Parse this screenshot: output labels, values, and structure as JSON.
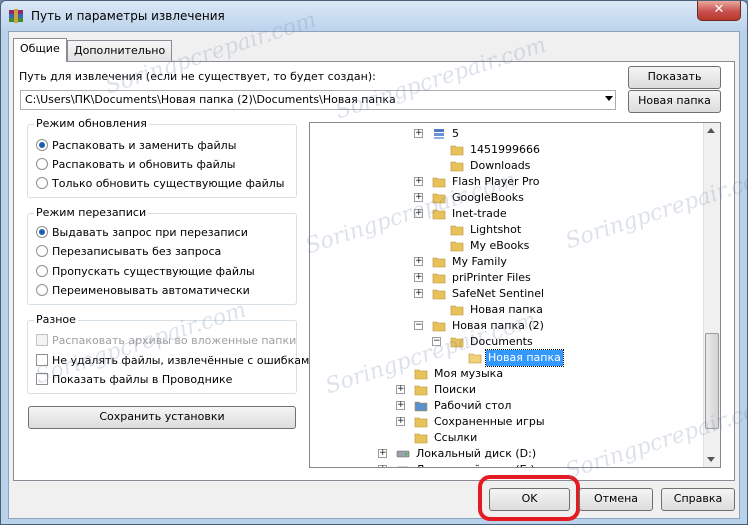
{
  "window": {
    "title": "Путь и параметры извлечения",
    "close_glyph": "✕"
  },
  "tabs": [
    {
      "label": "Общие",
      "active": true
    },
    {
      "label": "Дополнительно",
      "active": false
    }
  ],
  "path": {
    "label": "Путь для извлечения (если не существует, то будет создан):",
    "value": "C:\\Users\\ПК\\Documents\\Новая папка (2)\\Documents\\Новая папка",
    "show_button": "Показать",
    "new_folder_button": "Новая папка"
  },
  "update_mode": {
    "title": "Режим обновления",
    "options": [
      {
        "label": "Распаковать и заменить файлы",
        "selected": true
      },
      {
        "label": "Распаковать и обновить файлы",
        "selected": false
      },
      {
        "label": "Только обновить существующие файлы",
        "selected": false
      }
    ]
  },
  "overwrite_mode": {
    "title": "Режим перезаписи",
    "options": [
      {
        "label": "Выдавать запрос при перезаписи",
        "selected": true
      },
      {
        "label": "Перезаписывать без запроса",
        "selected": false
      },
      {
        "label": "Пропускать существующие файлы",
        "selected": false
      },
      {
        "label": "Переименовывать автоматически",
        "selected": false
      }
    ]
  },
  "misc": {
    "title": "Разное",
    "options": [
      {
        "label": "Распаковать архивы во вложенные папки",
        "checked": false,
        "disabled": true
      },
      {
        "label": "Не удалять файлы, извлечённые с ошибками",
        "checked": false,
        "disabled": false
      },
      {
        "label": "Показать файлы в Проводнике",
        "checked": false,
        "disabled": false
      }
    ]
  },
  "save_settings_button": "Сохранить установки",
  "tree": {
    "items": [
      {
        "label": "5",
        "icon": "stack-icon",
        "expander": "+"
      },
      {
        "label": "1451999666",
        "icon": "folder-icon",
        "expander": ""
      },
      {
        "label": "Downloads",
        "icon": "folder-icon",
        "expander": ""
      },
      {
        "label": "Flash Player Pro",
        "icon": "folder-icon",
        "expander": "+"
      },
      {
        "label": "GoogleBooks",
        "icon": "folder-icon",
        "expander": "+"
      },
      {
        "label": "Inet-trade",
        "icon": "folder-icon",
        "expander": "+"
      },
      {
        "label": "Lightshot",
        "icon": "folder-icon",
        "expander": ""
      },
      {
        "label": "My eBooks",
        "icon": "folder-icon",
        "expander": ""
      },
      {
        "label": "My Family",
        "icon": "folder-icon",
        "expander": "+"
      },
      {
        "label": "priPrinter Files",
        "icon": "folder-icon",
        "expander": "+"
      },
      {
        "label": "SafeNet Sentinel",
        "icon": "folder-icon",
        "expander": "+"
      },
      {
        "label": "Новая папка",
        "icon": "folder-icon",
        "expander": ""
      },
      {
        "label": "Новая папка (2)",
        "icon": "folder-icon",
        "expander": "−"
      },
      {
        "label": "Documents",
        "icon": "folder-icon",
        "expander": "−"
      },
      {
        "label": "Новая папка",
        "icon": "folder-open-icon",
        "expander": "",
        "selected": true
      },
      {
        "label": "Моя музыка",
        "icon": "music-folder-icon",
        "expander": ""
      },
      {
        "label": "Поиски",
        "icon": "search-folder-icon",
        "expander": "+"
      },
      {
        "label": "Рабочий стол",
        "icon": "desktop-folder-icon",
        "expander": "+"
      },
      {
        "label": "Сохраненные игры",
        "icon": "games-folder-icon",
        "expander": "+"
      },
      {
        "label": "Ссылки",
        "icon": "links-folder-icon",
        "expander": ""
      },
      {
        "label": "Локальный диск (D:)",
        "icon": "drive-icon",
        "expander": "+"
      },
      {
        "label": "Локальный диск (E:)",
        "icon": "drive-icon",
        "expander": "+"
      }
    ]
  },
  "footer": {
    "ok_button": "OK",
    "cancel_button": "Отмена",
    "help_button": "Справка"
  },
  "watermark_text": "Soringpcrepair.com",
  "colors": {
    "highlight_ring": "#e31b22",
    "selection": "#3399ff"
  }
}
